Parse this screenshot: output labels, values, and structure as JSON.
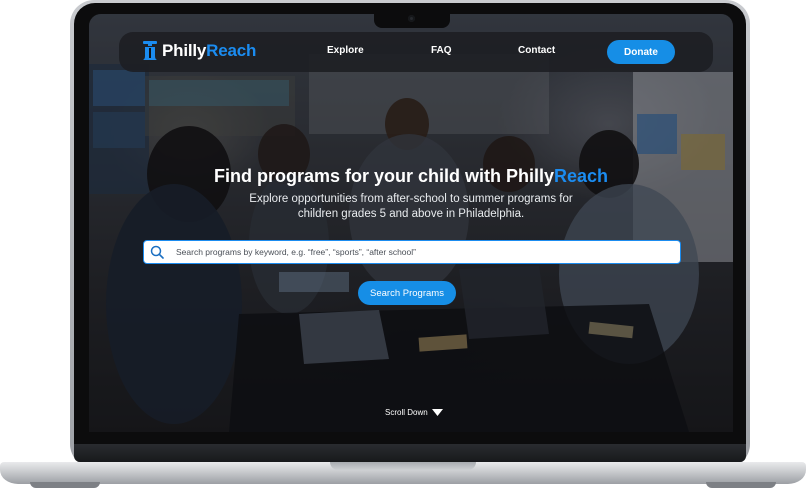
{
  "nav": {
    "logo_main": "Philly",
    "logo_accent": "Reach",
    "links": [
      {
        "label": "Explore"
      },
      {
        "label": "FAQ"
      },
      {
        "label": "Contact"
      }
    ],
    "donate_label": "Donate"
  },
  "hero": {
    "title_main": "Find programs for your child with Philly",
    "title_accent": "Reach",
    "subtitle": "Explore opportunities from after-school to summer programs for children grades 5 and above in Philadelphia."
  },
  "search": {
    "placeholder": "Search programs by keyword, e.g. “free”, “sports”, “after school”",
    "value": "",
    "button_label": "Search Programs"
  },
  "scroll": {
    "label": "Scroll Down"
  },
  "colors": {
    "brand_blue": "#168ee6",
    "accent_blue": "#1b8cf0",
    "nav_bg": "#1c1e22"
  }
}
